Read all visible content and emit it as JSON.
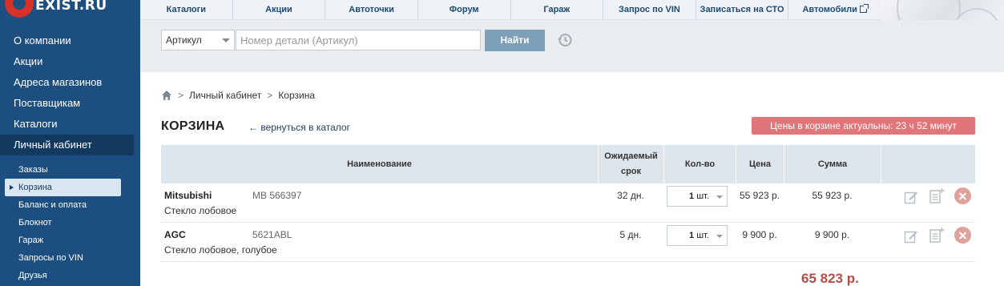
{
  "brand": {
    "logo_text": "EXIST.RU"
  },
  "sidebar": {
    "main_items": [
      {
        "label": "О компании"
      },
      {
        "label": "Акции"
      },
      {
        "label": "Адреса магазинов"
      },
      {
        "label": "Поставщикам"
      },
      {
        "label": "Каталоги"
      },
      {
        "label": "Личный кабинет"
      }
    ],
    "sub_items": [
      {
        "label": "Заказы"
      },
      {
        "label": "Корзина"
      },
      {
        "label": "Баланс и оплата"
      },
      {
        "label": "Блокнот"
      },
      {
        "label": "Гараж"
      },
      {
        "label": "Запросы по VIN"
      },
      {
        "label": "Друзья"
      }
    ]
  },
  "topnav": {
    "items": [
      {
        "label": "Каталоги"
      },
      {
        "label": "Акции"
      },
      {
        "label": "Автоточки"
      },
      {
        "label": "Форум"
      },
      {
        "label": "Гараж"
      },
      {
        "label": "Запрос по VIN"
      },
      {
        "label": "Записаться на СТО"
      },
      {
        "label": "Автомобили"
      }
    ]
  },
  "search": {
    "select_value": "Артикул",
    "placeholder": "Номер детали (Артикул)",
    "button_label": "Найти"
  },
  "breadcrumb": {
    "items": [
      {
        "label": "Личный кабинет"
      },
      {
        "label": "Корзина"
      }
    ],
    "separator": ">"
  },
  "page": {
    "title": "КОРЗИНА",
    "back_link": "← вернуться в каталог",
    "notice": "Цены в корзине актуальны: 23 ч 52 минут"
  },
  "table": {
    "headers": {
      "name": "Наименование",
      "term_line1": "Ожидаемый",
      "term_line2": "срок",
      "qty": "Кол-во",
      "price": "Цена",
      "sum": "Сумма"
    },
    "rows": [
      {
        "brand": "Mitsubishi",
        "article": "MB 566397",
        "description": "Стекло лобовое",
        "term": "32 дн.",
        "qty": "1",
        "unit": "шт.",
        "price": "55 923 р.",
        "sum": "55 923 р."
      },
      {
        "brand": "AGC",
        "article": "5621ABL",
        "description": "Стекло лобовое, голубое",
        "term": "5 дн.",
        "qty": "1",
        "unit": "шт.",
        "price": "9 900 р.",
        "sum": "9 900 р."
      }
    ],
    "total": "65 823 р."
  },
  "colors": {
    "sidebar_bg": "#1c4f7f",
    "notice_bg": "#e0767a",
    "total_text": "#b44c48",
    "search_button": "#7d9fb8"
  },
  "icons": {
    "history": "history-icon",
    "home": "home-icon",
    "edit": "edit-icon",
    "note": "add-note-icon",
    "delete": "delete-icon",
    "external": "external-link-icon"
  }
}
